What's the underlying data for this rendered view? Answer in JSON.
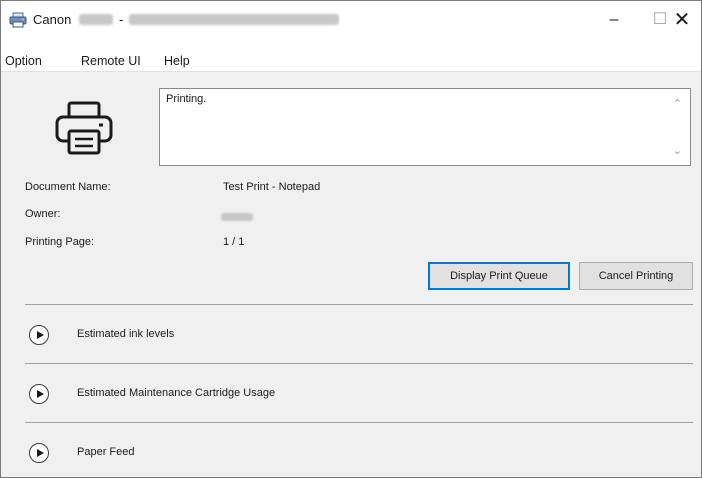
{
  "window": {
    "title": "Canon",
    "title_separator": "-",
    "controls": {
      "minimize": "–",
      "maximize": "☐",
      "close": "✕"
    }
  },
  "menu": [
    "Option",
    "Remote UI",
    "Help"
  ],
  "status": {
    "text": "Printing.",
    "scroll_up": "⌃",
    "scroll_down": "⌄"
  },
  "info": {
    "document_label": "Document Name:",
    "document_value": "Test Print - Notepad",
    "owner_label": "Owner:",
    "page_label": "Printing Page:",
    "page_value": "1 / 1"
  },
  "buttons": {
    "display_queue": "Display Print Queue",
    "cancel": "Cancel Printing"
  },
  "sections": [
    {
      "label": "Estimated ink levels"
    },
    {
      "label": "Estimated Maintenance Cartridge Usage"
    },
    {
      "label": "Paper Feed"
    }
  ]
}
